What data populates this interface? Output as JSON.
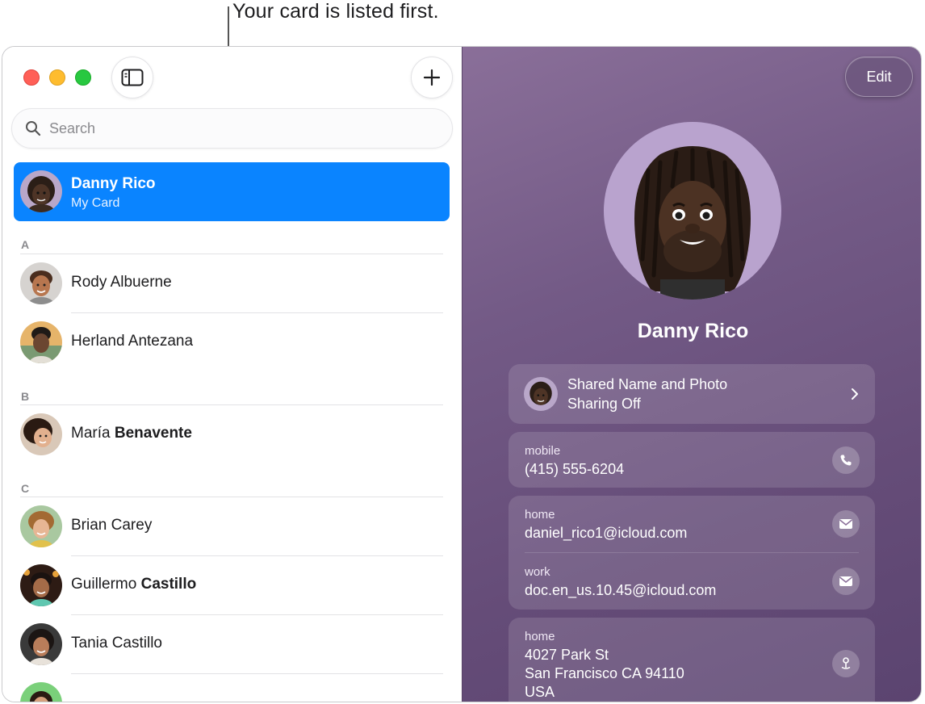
{
  "callout": "Your card is listed first.",
  "search": {
    "placeholder": "Search"
  },
  "my_card": {
    "name": "Danny Rico",
    "subtitle": "My Card"
  },
  "sections": [
    {
      "letter": "A",
      "contacts": [
        {
          "first": "Rody",
          "last": "Albuerne"
        },
        {
          "first": "Herland",
          "last": "Antezana"
        }
      ]
    },
    {
      "letter": "B",
      "contacts": [
        {
          "first": "María",
          "last": "Benavente"
        }
      ]
    },
    {
      "letter": "C",
      "contacts": [
        {
          "first": "Brian",
          "last": "Carey"
        },
        {
          "first": "Guillermo",
          "last": "Castillo"
        },
        {
          "first": "Tania",
          "last": "Castillo"
        }
      ]
    }
  ],
  "detail": {
    "edit_label": "Edit",
    "name": "Danny Rico",
    "sharing": {
      "title": "Shared Name and Photo",
      "status": "Sharing Off"
    },
    "phone": {
      "label": "mobile",
      "value": "(415) 555-6204"
    },
    "emails": [
      {
        "label": "home",
        "value": "daniel_rico1@icloud.com"
      },
      {
        "label": "work",
        "value": "doc.en_us.10.45@icloud.com"
      }
    ],
    "address": {
      "label": "home",
      "line1": "4027 Park St",
      "line2": "San Francisco CA 94110",
      "line3": "USA"
    }
  },
  "colors": {
    "accent": "#0a84ff",
    "detail_background": "#6e5582"
  },
  "icons": [
    "sidebar-toggle-icon",
    "plus-icon",
    "search-icon",
    "chevron-right-icon",
    "phone-icon",
    "envelope-icon",
    "map-pin-icon"
  ]
}
